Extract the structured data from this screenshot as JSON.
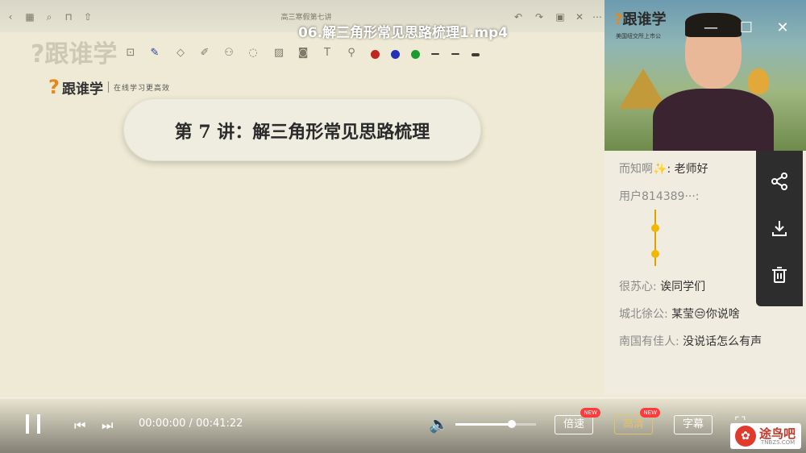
{
  "video": {
    "title": "06.解三角形常见思路梳理1.mp4"
  },
  "tablet": {
    "doc_title": "高三寒假第七讲"
  },
  "slide": {
    "brand_name": "跟谁学",
    "brand_slogan": "在线学习更高效",
    "lecture_title": "第 7 讲：解三角形常见思路梳理",
    "pen_colors": [
      "#c0261f",
      "#2531b5",
      "#1e9a2e"
    ]
  },
  "camera": {
    "logo_text": "跟谁学",
    "subtitle": "美国纽交所上市公"
  },
  "chat": {
    "messages": [
      {
        "user": "而知啊",
        "text": "老师好",
        "emoji": "✨"
      },
      {
        "user": "用户814389···:",
        "text": "",
        "sticker": true
      },
      {
        "user": "很苏心:",
        "text": "诶同学们"
      },
      {
        "user": "城北徐公:",
        "text": "某莹😒你说啥"
      },
      {
        "user": "南国有佳人:",
        "text": "没说话怎么有声"
      }
    ]
  },
  "actions": {
    "share_icon": "share-icon",
    "download_icon": "download-icon",
    "delete_icon": "trash-icon"
  },
  "player": {
    "current_time": "00:00:00",
    "duration": "00:41:22",
    "time_display": "00:00:00 / 00:41:22",
    "progress": 0.0,
    "volume": 0.7,
    "speed_label": "倍速",
    "quality_label": "高清",
    "subtitle_label": "字幕",
    "new_badge": "NEW"
  },
  "watermark": {
    "site_name": "途鸟吧",
    "site_domain": "TNBZS.COM"
  }
}
